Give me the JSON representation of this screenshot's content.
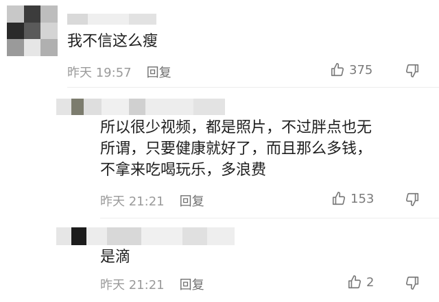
{
  "comments": [
    {
      "text": "我不信这么瘦",
      "time": "昨天 19:57",
      "reply_label": "回复",
      "likes": "375",
      "like_icon": "thumbs-up-icon",
      "dislike_icon": "thumbs-down-icon"
    },
    {
      "text": "所以很少视频，都是照片，不过胖点也无\n所谓，只要健康就好了，而且那么多钱，\n不拿来吃喝玩乐，多浪费",
      "time": "昨天 21:21",
      "reply_label": "回复",
      "likes": "153",
      "like_icon": "thumbs-up-icon",
      "dislike_icon": "thumbs-down-icon"
    },
    {
      "text": "是滴",
      "time": "昨天 21:21",
      "reply_label": "回复",
      "likes": "2",
      "like_icon": "thumbs-up-icon",
      "dislike_icon": "thumbs-down-icon"
    }
  ]
}
